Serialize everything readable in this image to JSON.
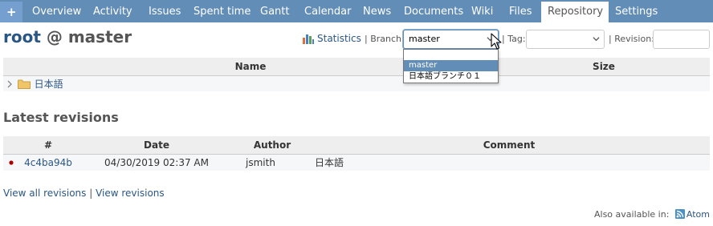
{
  "tabs": [
    {
      "label": "+",
      "selected": false
    },
    {
      "label": "Overview",
      "selected": false
    },
    {
      "label": "Activity",
      "selected": false
    },
    {
      "label": "Issues",
      "selected": false
    },
    {
      "label": "Spent time",
      "selected": false
    },
    {
      "label": "Gantt",
      "selected": false
    },
    {
      "label": "Calendar",
      "selected": false
    },
    {
      "label": "News",
      "selected": false
    },
    {
      "label": "Documents",
      "selected": false
    },
    {
      "label": "Wiki",
      "selected": false
    },
    {
      "label": "Files",
      "selected": false
    },
    {
      "label": "Repository",
      "selected": true
    },
    {
      "label": "Settings",
      "selected": false
    }
  ],
  "title": {
    "root": "root",
    "sep": " @ ",
    "branch": "master"
  },
  "toolbar": {
    "statistics": "Statistics",
    "branch_label": "| Branch:",
    "branch_value": "master",
    "tag_label": "| Tag:",
    "tag_value": "",
    "revision_label": "| Revision:",
    "revision_value": ""
  },
  "branch_dropdown": {
    "options": [
      "",
      "master",
      "日本語ブランチ０１"
    ],
    "highlighted": "master"
  },
  "files_table": {
    "columns": [
      "Name",
      "Size"
    ],
    "rows": [
      {
        "name": "日本語",
        "type": "folder",
        "size": ""
      }
    ]
  },
  "latest_revisions": {
    "title": "Latest revisions",
    "columns": [
      "#",
      "Date",
      "Author",
      "Comment"
    ],
    "rows": [
      {
        "id": "4c4ba94b",
        "date": "04/30/2019 02:37 AM",
        "author": "jsmith",
        "comment": "日本語"
      }
    ]
  },
  "links": {
    "view_all": "View all revisions",
    "separator": " | ",
    "view": "View revisions"
  },
  "footer": {
    "also_available": "Also available in:",
    "atom": "Atom"
  },
  "colors": {
    "tab_bar": "#628db6",
    "link": "#2a5685",
    "highlight": "#628db6",
    "revision_dot": "#aa0000",
    "folder": "#f0c56a"
  }
}
